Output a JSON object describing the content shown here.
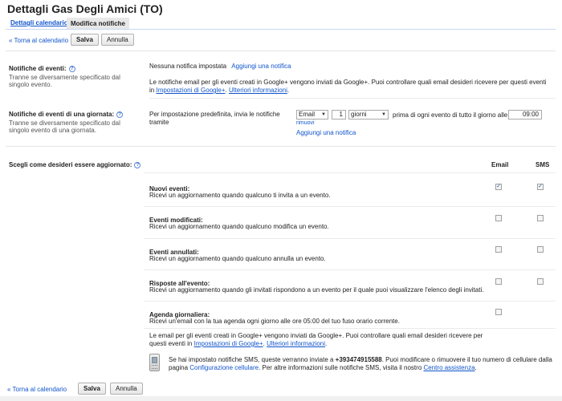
{
  "page": {
    "title": "Dettagli Gas Degli Amici (TO)"
  },
  "tabs": [
    {
      "label": "Dettagli calendario"
    },
    {
      "label": "Modifica notifiche"
    }
  ],
  "toolbar": {
    "back_label": "« Torna al calendario",
    "save_label": "Salva",
    "cancel_label": "Annulla"
  },
  "event_notifications": {
    "label": "Notifiche di eventi:",
    "description": "Tranne se diversamente specificato dal singolo evento.",
    "status": "Nessuna notifica impostata",
    "add_link": "Aggiungi una notifica",
    "info_text": "Le notifiche email per gli eventi creati in Google+ vengono inviati da Google+. Puoi controllare quali email desideri ricevere per questi eventi in",
    "settings_link": "Impostazioni di Google+",
    "sep": ". ",
    "more_link": "Ulteriori informazioni",
    "end": "."
  },
  "allday_notifications": {
    "label": "Notifiche di eventi di una giornata:",
    "description": "Tranne se diversamente specificato dal singolo evento di una giornata.",
    "default_text": "Per impostazione predefinita, invia le notifiche tramite",
    "method": "Email",
    "amount": "1",
    "unit": "giorni",
    "before_text": "prima di ogni evento di tutto il giorno alle",
    "time": "09:00",
    "remove_link": "rimuovi",
    "add_link": "Aggiungi una notifica"
  },
  "updates": {
    "label": "Scegli come desideri essere aggiornato:",
    "col_email": "Email",
    "col_sms": "SMS",
    "rows": [
      {
        "title": "Nuovi eventi:",
        "desc": "Ricevi un aggiornamento quando qualcuno ti invita a un evento.",
        "email": true,
        "sms": true
      },
      {
        "title": "Eventi modificati:",
        "desc": "Ricevi un aggiornamento quando qualcuno modifica un evento.",
        "email": false,
        "sms": false
      },
      {
        "title": "Eventi annullati:",
        "desc": "Ricevi un aggiornamento quando qualcuno annulla un evento.",
        "email": false,
        "sms": false
      },
      {
        "title": "Risposte all'evento:",
        "desc": "Ricevi un aggiornamento quando gli invitati rispondono a un evento per il quale puoi visualizzare l'elenco degli invitati.",
        "email": false,
        "sms": false
      },
      {
        "title": "Agenda giornaliera:",
        "desc": "Ricevi un'email con la tua agenda ogni giorno alle ore 05:00 del tuo fuso orario corrente.",
        "email": false
      }
    ],
    "footer_text": "Le email per gli eventi creati in Google+ vengono inviati da Google+. Puoi controllare quali email desideri ricevere per questi eventi in",
    "footer_settings_link": "Impostazioni di Google+",
    "footer_sep": ". ",
    "footer_more_link": "Ulteriori informazioni",
    "footer_end": "."
  },
  "sms": {
    "text_a": "Se hai impostato notifiche SMS, queste verranno inviate a ",
    "number": "+393474915588",
    "text_b": ". Puoi modificare o rimuovere il tuo numero di cellulare dalla pagina ",
    "config_link": "Configurazione cellulare",
    "text_c": ". Per altre informazioni sulle notifiche SMS, visita il nostro ",
    "help_link": "Centro assistenza",
    "end": "."
  }
}
